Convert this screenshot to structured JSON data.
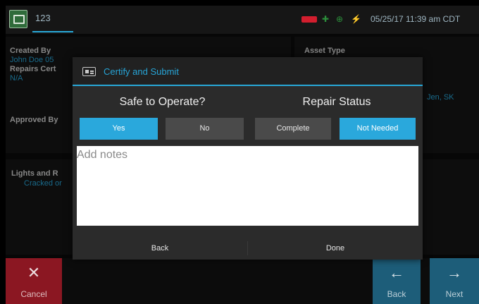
{
  "statusbar": {
    "tab_label": "123",
    "timestamp": "05/25/17 11:39 am CDT",
    "icons": [
      "app-icon",
      "battery-low-icon",
      "gps-icon",
      "settings-icon",
      "power-icon"
    ]
  },
  "background": {
    "created_by_label": "Created By",
    "created_by_value": "John Doe 05",
    "repairs_cert_label": "Repairs Cert",
    "repairs_cert_value": "N/A",
    "approved_by_label": "Approved By",
    "asset_type_label": "Asset Type",
    "asset_value": "Jen, SK",
    "lights_label": "Lights and R",
    "lights_value": "Cracked or"
  },
  "modal": {
    "title": "Certify and Submit",
    "safe_label": "Safe to Operate?",
    "repair_label": "Repair Status",
    "safe_options": [
      {
        "label": "Yes",
        "selected": true
      },
      {
        "label": "No",
        "selected": false
      }
    ],
    "repair_options": [
      {
        "label": "Complete",
        "selected": false
      },
      {
        "label": "Not Needed",
        "selected": true
      }
    ],
    "notes_placeholder": "Add notes",
    "notes_value": "",
    "back_label": "Back",
    "done_label": "Done"
  },
  "bottom_nav": {
    "cancel_label": "Cancel",
    "back_label": "Back",
    "next_label": "Next"
  },
  "colors": {
    "accent": "#2aa8dc",
    "cancel": "#8b1722",
    "nav_blue": "#1d5d79",
    "modal_bg": "#2b2b2b",
    "status_red": "#d21e2e"
  }
}
